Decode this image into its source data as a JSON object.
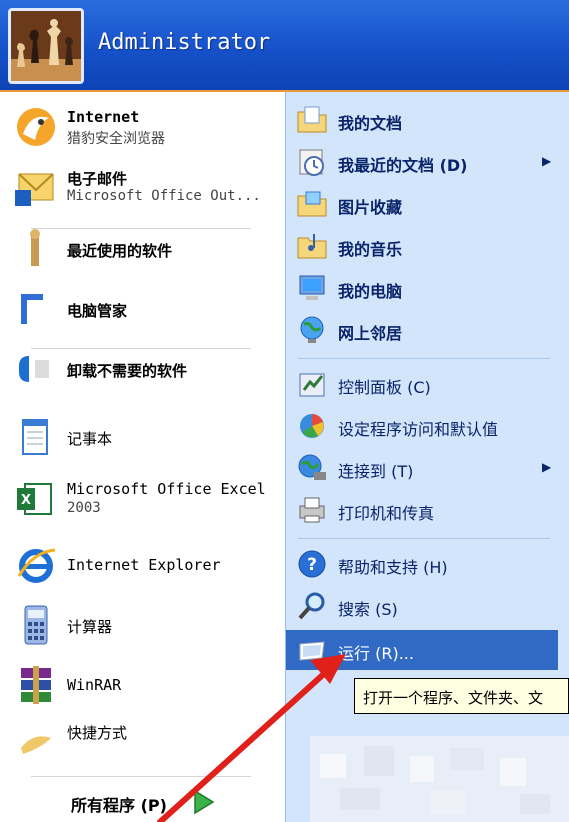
{
  "header": {
    "username": "Administrator"
  },
  "left": {
    "items": [
      {
        "line1": "Internet",
        "line2": "猎豹安全浏览器",
        "icon": "cheetah-browser-icon"
      },
      {
        "line1": "电子邮件",
        "line2": "Microsoft Office Out...",
        "icon": "outlook-icon"
      },
      {
        "line1": "最近使用的软件",
        "line2": "",
        "icon": "app-icon"
      },
      {
        "line1": "电脑管家",
        "line2": "",
        "icon": "pc-manager-icon"
      },
      {
        "line1": "卸载不需要的软件",
        "line2": "",
        "icon": "uninstall-icon"
      },
      {
        "line1": "记事本",
        "line2": "",
        "icon": "notepad-icon"
      },
      {
        "line1": "Microsoft Office Excel",
        "line2": "2003",
        "icon": "excel-icon"
      },
      {
        "line1": "Internet Explorer",
        "line2": "",
        "icon": "internet-explorer-icon"
      },
      {
        "line1": "计算器",
        "line2": "",
        "icon": "calculator-icon"
      },
      {
        "line1": "WinRAR",
        "line2": "",
        "icon": "winrar-icon"
      },
      {
        "line1": "快捷方式",
        "line2": "",
        "icon": "shortcut-icon"
      }
    ],
    "all_programs": "所有程序 (P)"
  },
  "right": {
    "items": [
      {
        "label": "我的文档",
        "icon": "my-documents-icon",
        "bold": true
      },
      {
        "label": "我最近的文档 (D)",
        "icon": "recent-documents-icon",
        "bold": true,
        "submenu": true
      },
      {
        "label": "图片收藏",
        "icon": "my-pictures-icon",
        "bold": true
      },
      {
        "label": "我的音乐",
        "icon": "my-music-icon",
        "bold": true
      },
      {
        "label": "我的电脑",
        "icon": "my-computer-icon",
        "bold": true
      },
      {
        "label": "网上邻居",
        "icon": "network-places-icon",
        "bold": true
      },
      {
        "label": "控制面板 (C)",
        "icon": "control-panel-icon"
      },
      {
        "label": "设定程序访问和默认值",
        "icon": "program-access-icon"
      },
      {
        "label": "连接到 (T)",
        "icon": "connect-to-icon",
        "submenu": true
      },
      {
        "label": "打印机和传真",
        "icon": "printers-faxes-icon"
      },
      {
        "label": "帮助和支持 (H)",
        "icon": "help-support-icon"
      },
      {
        "label": "搜索 (S)",
        "icon": "search-icon"
      },
      {
        "label": "运行 (R)...",
        "icon": "run-icon",
        "selected": true
      }
    ],
    "submenu_glyph": "▶"
  },
  "tooltip": {
    "text": "打开一个程序、文件夹、文"
  },
  "colors": {
    "header_blue": "#1651c9",
    "right_pane_bg": "#d3e5fa",
    "selection": "#316ac5",
    "tooltip_bg": "#ffffe1",
    "pointer_red": "#e0201b"
  }
}
